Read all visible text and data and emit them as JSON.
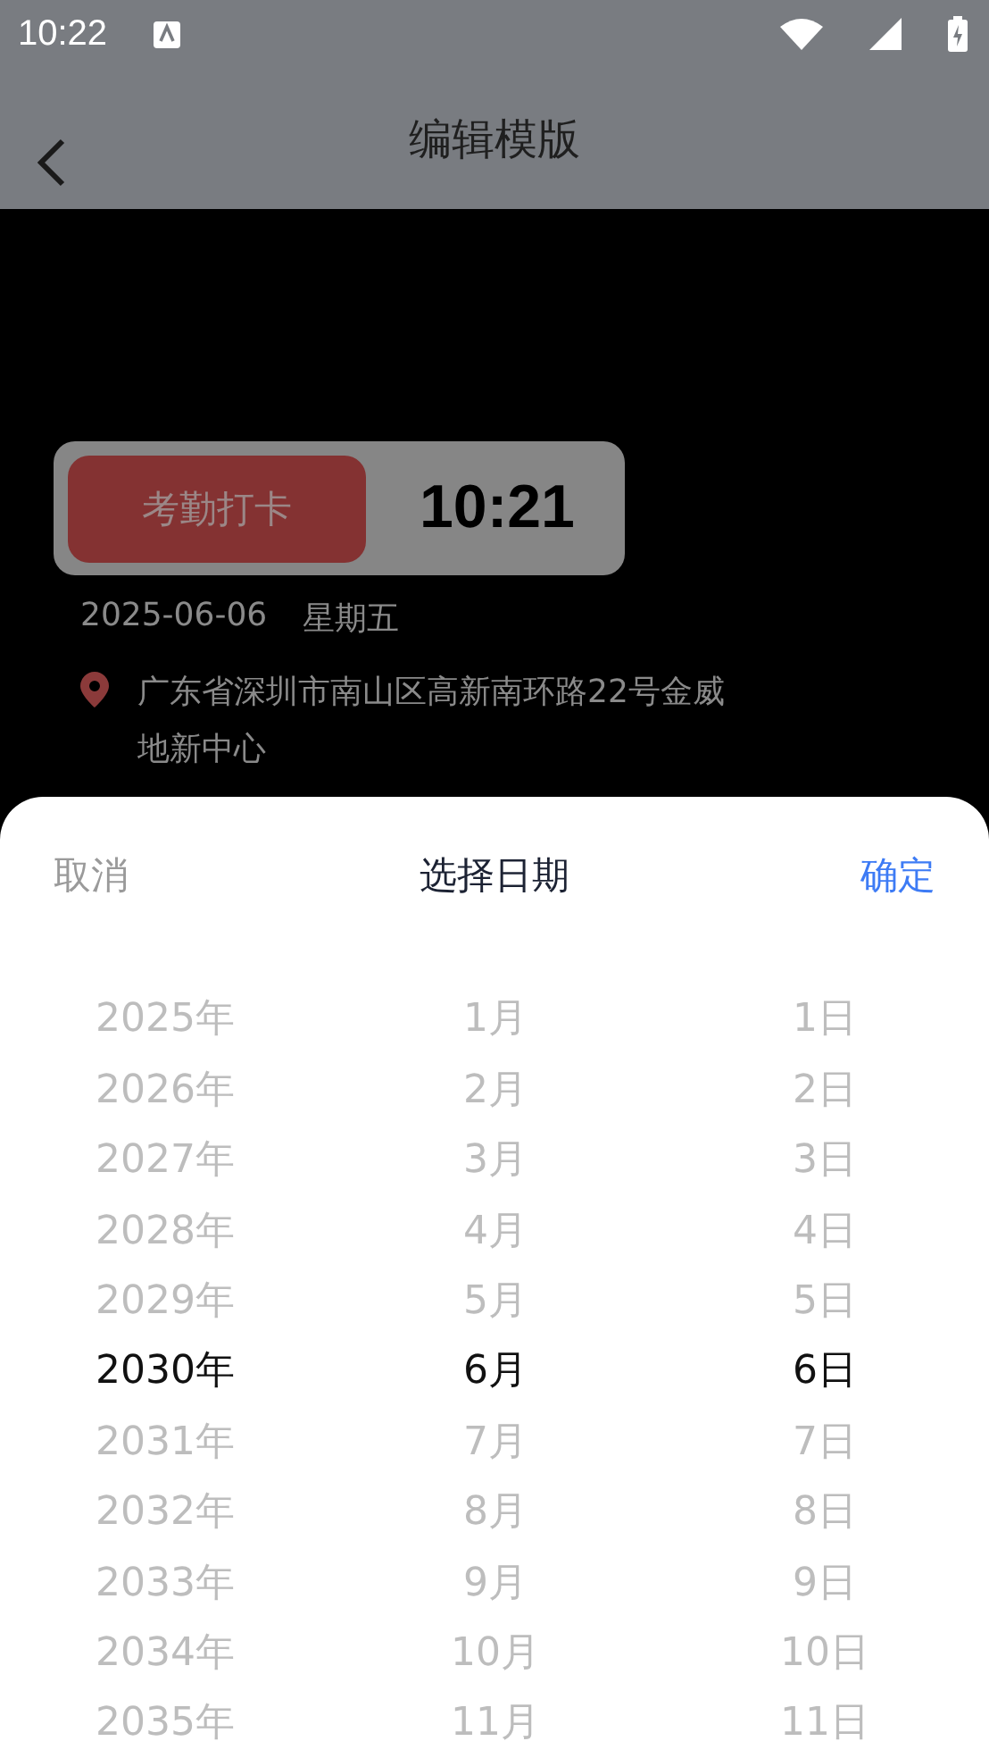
{
  "status_bar": {
    "time": "10:22"
  },
  "header": {
    "title": "编辑模版"
  },
  "card": {
    "button": "考勤打卡",
    "time": "10:21",
    "date": "2025-06-06",
    "weekday": "星期五",
    "address": "广东省深圳市南山区高新南环路22号金威地新中心"
  },
  "sheet": {
    "cancel": "取消",
    "title": "选择日期",
    "confirm": "确定",
    "columns": [
      {
        "items": [
          {
            "label": "2025年",
            "selected": false
          },
          {
            "label": "2026年",
            "selected": false
          },
          {
            "label": "2027年",
            "selected": false
          },
          {
            "label": "2028年",
            "selected": false
          },
          {
            "label": "2029年",
            "selected": false
          },
          {
            "label": "2030年",
            "selected": true
          },
          {
            "label": "2031年",
            "selected": false
          },
          {
            "label": "2032年",
            "selected": false
          },
          {
            "label": "2033年",
            "selected": false
          },
          {
            "label": "2034年",
            "selected": false
          },
          {
            "label": "2035年",
            "selected": false
          }
        ]
      },
      {
        "items": [
          {
            "label": "1月",
            "selected": false
          },
          {
            "label": "2月",
            "selected": false
          },
          {
            "label": "3月",
            "selected": false
          },
          {
            "label": "4月",
            "selected": false
          },
          {
            "label": "5月",
            "selected": false
          },
          {
            "label": "6月",
            "selected": true
          },
          {
            "label": "7月",
            "selected": false
          },
          {
            "label": "8月",
            "selected": false
          },
          {
            "label": "9月",
            "selected": false
          },
          {
            "label": "10月",
            "selected": false
          },
          {
            "label": "11月",
            "selected": false
          }
        ]
      },
      {
        "items": [
          {
            "label": "1日",
            "selected": false
          },
          {
            "label": "2日",
            "selected": false
          },
          {
            "label": "3日",
            "selected": false
          },
          {
            "label": "4日",
            "selected": false
          },
          {
            "label": "5日",
            "selected": false
          },
          {
            "label": "6日",
            "selected": true
          },
          {
            "label": "7日",
            "selected": false
          },
          {
            "label": "8日",
            "selected": false
          },
          {
            "label": "9日",
            "selected": false
          },
          {
            "label": "10日",
            "selected": false
          },
          {
            "label": "11日",
            "selected": false
          }
        ]
      }
    ]
  }
}
